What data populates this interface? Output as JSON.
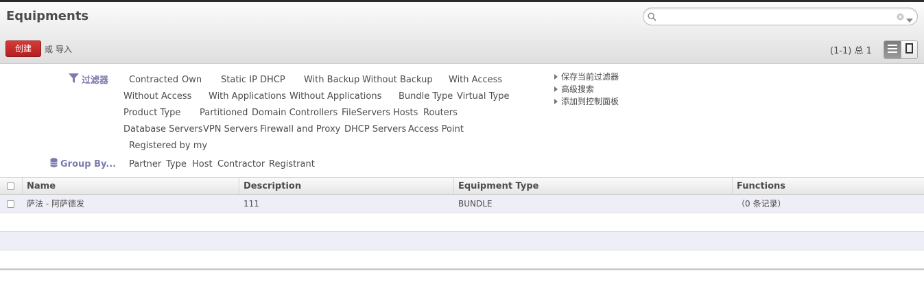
{
  "page": {
    "title": "Equipments"
  },
  "search": {
    "placeholder": "",
    "value": ""
  },
  "toolbar": {
    "create_label": "创建",
    "or_text": "或",
    "import_label": "导入"
  },
  "pager": {
    "text": "(1-1) 总 1"
  },
  "filters": {
    "filter_heading": "过滤器",
    "filter_options": [
      "Contracted",
      "Own",
      "Static IP",
      "DHCP",
      "With Backup",
      "Without Backup",
      "With Access",
      "Without Access",
      "With Applications",
      "Without Applications",
      "Bundle Type",
      "Virtual Type",
      "Product Type",
      "Partitioned",
      "Domain Controllers",
      "FileServers",
      "Hosts",
      "Routers",
      "Database Servers",
      "VPN Servers",
      "Firewall and Proxy",
      "DHCP Servers",
      "Access Point",
      "Registered by my"
    ],
    "group_heading": "Group By...",
    "group_options": [
      "Partner",
      "Type",
      "Host",
      "Contractor",
      "Registrant"
    ],
    "side_links": [
      "保存当前过滤器",
      "高级搜索",
      "添加到控制面板"
    ]
  },
  "table": {
    "columns": [
      "Name",
      "Description",
      "Equipment Type",
      "Functions"
    ],
    "rows": [
      {
        "name": "萨法 - 阿萨德发",
        "description": "111",
        "type": "BUNDLE",
        "functions": "（0 条记录）"
      }
    ]
  },
  "colors": {
    "accent": "#7c7bad",
    "create_button": "#c0272d",
    "row_highlight": "#eeeef6"
  }
}
